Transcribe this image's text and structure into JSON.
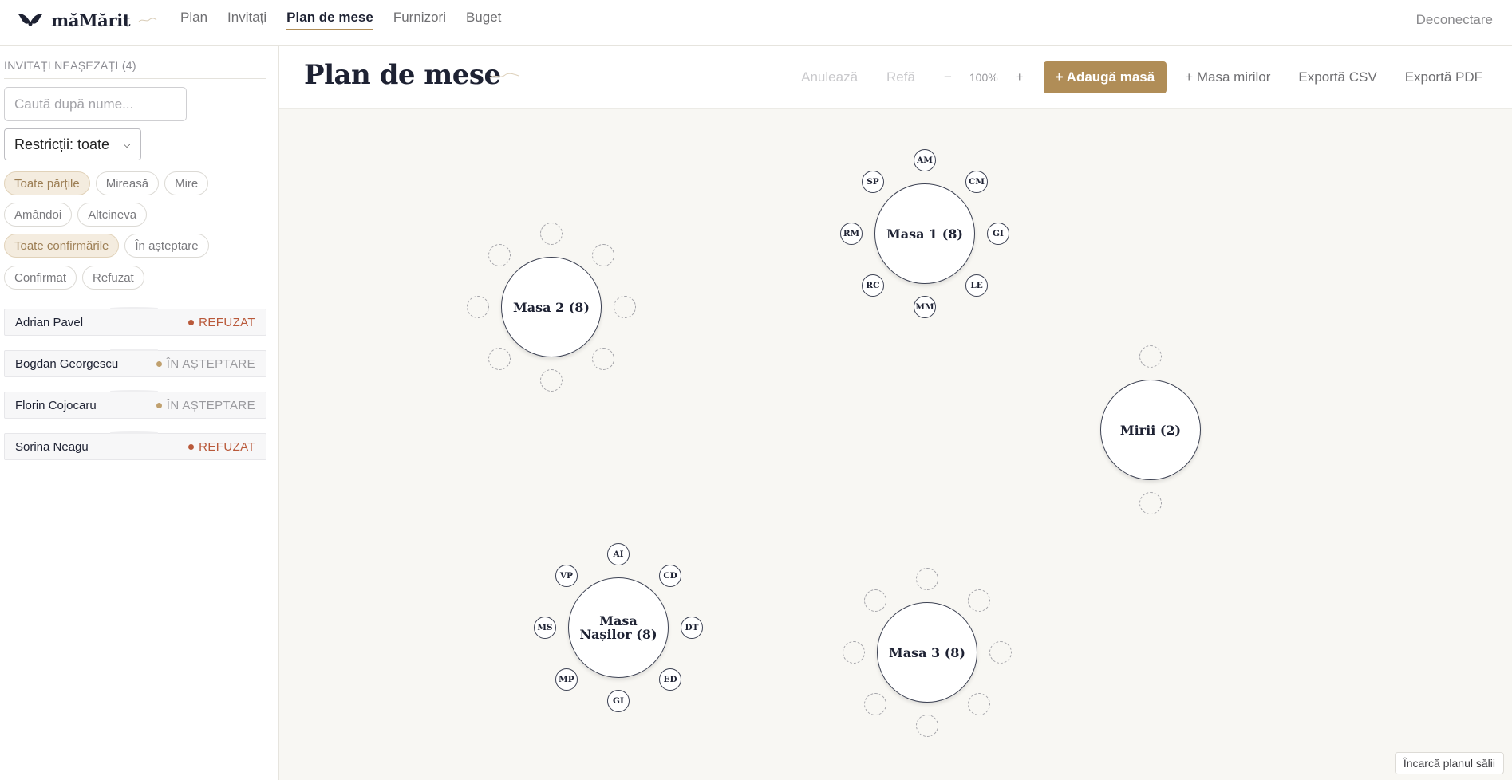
{
  "app": {
    "logo_text": "măMărit"
  },
  "nav": {
    "links": [
      {
        "label": "Plan",
        "active": false
      },
      {
        "label": "Invitați",
        "active": false
      },
      {
        "label": "Plan de mese",
        "active": true
      },
      {
        "label": "Furnizori",
        "active": false
      },
      {
        "label": "Buget",
        "active": false
      }
    ],
    "logout": "Deconectare"
  },
  "sidebar": {
    "title": "INVITAȚI NEAȘEZAȚI",
    "count": "(4)",
    "search_placeholder": "Caută după nume...",
    "restrictions_select": "Restricții: toate",
    "side_filters": [
      "Toate părțile",
      "Mireasă",
      "Mire",
      "Amândoi",
      "Altcineva"
    ],
    "rsvp_filters": [
      "Toate confirmările",
      "În așteptare",
      "Confirmat",
      "Refuzat"
    ],
    "guests": [
      {
        "name": "Adrian Pavel",
        "status": "REFUZAT",
        "status_color": "#b9593a"
      },
      {
        "name": "Bogdan Georgescu",
        "status": "ÎN AȘTEPTARE",
        "status_color": "#9a9a9e",
        "dot_color": "#c0a06e"
      },
      {
        "name": "Florin Cojocaru",
        "status": "ÎN AȘTEPTARE",
        "status_color": "#9a9a9e",
        "dot_color": "#c0a06e"
      },
      {
        "name": "Sorina Neagu",
        "status": "REFUZAT",
        "status_color": "#b9593a"
      }
    ]
  },
  "header": {
    "title": "Plan de mese",
    "undo": "Anulează",
    "redo": "Refă",
    "zoom_out": "−",
    "zoom": "100%",
    "zoom_in": "+",
    "add_table": "+ Adaugă masă",
    "couple_table": "+ Masa mirilor",
    "export_csv": "Exportă CSV",
    "export_pdf": "Exportă PDF"
  },
  "tables": [
    {
      "name": "Masa 1 (8)",
      "seats": [
        "AM",
        "CM",
        "GI",
        "LE",
        "MM",
        "RC",
        "RM",
        "SP"
      ]
    },
    {
      "name": "Masa 2 (8)",
      "seats": [
        "",
        "",
        "",
        "",
        "",
        "",
        "",
        ""
      ]
    },
    {
      "name": "Mirii (2)",
      "seats": [
        "",
        ""
      ]
    },
    {
      "name": "Masa Nașilor (8)",
      "seats": [
        "AI",
        "CD",
        "DT",
        "ED",
        "GI",
        "MP",
        "MS",
        "VP"
      ]
    },
    {
      "name": "Masa 3 (8)",
      "seats": [
        "",
        "",
        "",
        "",
        "",
        "",
        "",
        ""
      ]
    }
  ],
  "upload_plan": "Încarcă planul sălii",
  "colors": {
    "accent": "#b08d57",
    "canvas": "#f8f7f3",
    "declined": "#b9593a"
  }
}
